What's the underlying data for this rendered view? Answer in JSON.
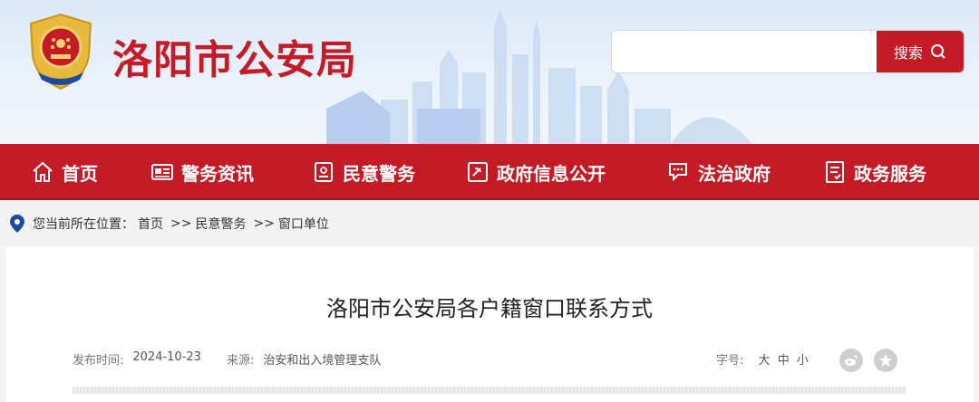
{
  "header": {
    "site_title": "洛阳市公安局",
    "search": {
      "placeholder": "",
      "button_label": "搜索"
    }
  },
  "nav": {
    "items": [
      {
        "label": "首页",
        "icon": "home-icon"
      },
      {
        "label": "警务资讯",
        "icon": "news-icon"
      },
      {
        "label": "民意警务",
        "icon": "mailbox-icon"
      },
      {
        "label": "政府信息公开",
        "icon": "party-flag-icon"
      },
      {
        "label": "法治政府",
        "icon": "chat-icon"
      },
      {
        "label": "政务服务",
        "icon": "document-icon"
      }
    ]
  },
  "breadcrumb": {
    "prefix": "您当前所在位置：",
    "items": [
      "首页",
      "民意警务",
      "窗口单位"
    ],
    "separator": ">>"
  },
  "article": {
    "title": "洛阳市公安局各户籍窗口联系方式",
    "publish_label": "发布时间:",
    "publish_date": "2024-10-23",
    "source_label": "来源:",
    "source": "治安和出入境管理支队",
    "font_size_label": "字号:",
    "font_sizes": [
      "大",
      "中",
      "小"
    ],
    "share_icons": [
      "weibo-icon",
      "favorite-star-icon"
    ]
  },
  "colors": {
    "brand_red": "#c41b27",
    "header_sky": "#dbe9f8"
  }
}
